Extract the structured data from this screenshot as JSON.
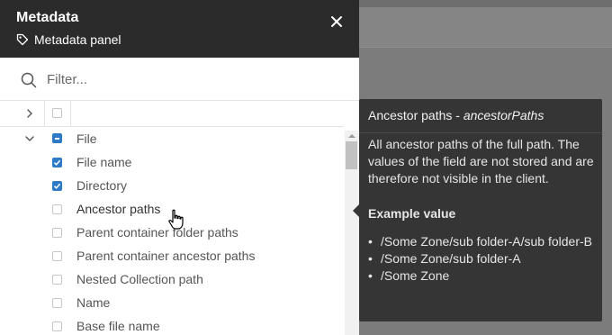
{
  "panel": {
    "title": "Metadata",
    "subtitle": "Metadata panel",
    "filter_placeholder": "Filter..."
  },
  "tree": {
    "group_label": "File",
    "items": [
      {
        "label": "File name",
        "checked": true
      },
      {
        "label": "Directory",
        "checked": true
      },
      {
        "label": "Ancestor paths",
        "checked": false
      },
      {
        "label": "Parent container folder paths",
        "checked": false
      },
      {
        "label": "Parent container ancestor paths",
        "checked": false
      },
      {
        "label": "Nested Collection path",
        "checked": false
      },
      {
        "label": "Name",
        "checked": false
      },
      {
        "label": "Base file name",
        "checked": false
      }
    ]
  },
  "tooltip": {
    "title_prefix": "Ancestor paths - ",
    "title_field": "ancestorPaths",
    "description": "All ancestor paths of the full path. The values of the field are not stored and are therefore not visible in the client.",
    "example_heading": "Example value",
    "examples": [
      "/Some Zone/sub folder-A/sub folder-B",
      "/Some Zone/sub folder-A",
      "/Some Zone"
    ]
  },
  "colors": {
    "header_bg": "#2b2b2b",
    "checkbox_accent": "#2d7ac6",
    "tooltip_bg": "#353535"
  },
  "icons": {
    "subtitle": "tag-icon",
    "close": "close-icon",
    "filter": "search-icon",
    "cursor": "hand-pointer-icon"
  }
}
